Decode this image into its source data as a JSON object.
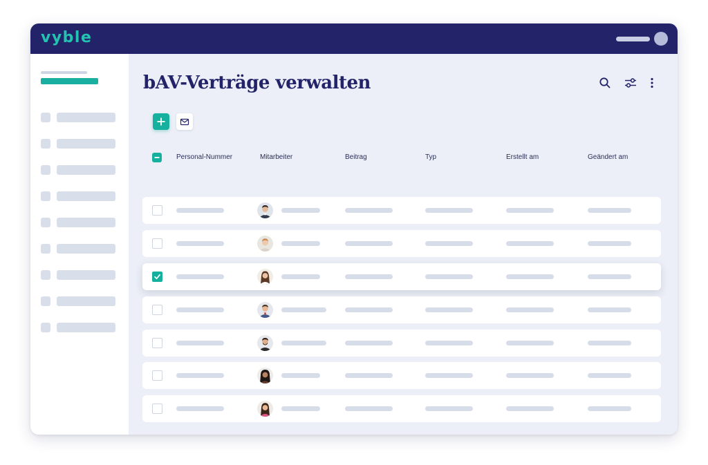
{
  "app": {
    "logo": "vyble"
  },
  "page": {
    "title": "bAV-Verträge verwalten"
  },
  "toolbar": {
    "icons": [
      "search-icon",
      "filter-sliders-icon",
      "more-vertical-icon"
    ],
    "actions": [
      "add-icon",
      "mail-icon"
    ]
  },
  "table": {
    "columns": [
      "Personal-Nummer",
      "Mitarbeiter",
      "Beitrag",
      "Typ",
      "Erstellt am",
      "Geändert am"
    ],
    "header_checkbox": "indeterminate",
    "rows": [
      {
        "selected": false,
        "avatar": "avatar-man-1"
      },
      {
        "selected": false,
        "avatar": "avatar-man-2"
      },
      {
        "selected": true,
        "avatar": "avatar-woman-1"
      },
      {
        "selected": false,
        "avatar": "avatar-man-3"
      },
      {
        "selected": false,
        "avatar": "avatar-man-4"
      },
      {
        "selected": false,
        "avatar": "avatar-woman-2"
      },
      {
        "selected": false,
        "avatar": "avatar-woman-3"
      }
    ]
  },
  "colors": {
    "topbar": "#23236a",
    "accent": "#16b09f",
    "logo": "#22c3b0",
    "background": "#eceff7",
    "placeholder": "#d7dde8"
  }
}
